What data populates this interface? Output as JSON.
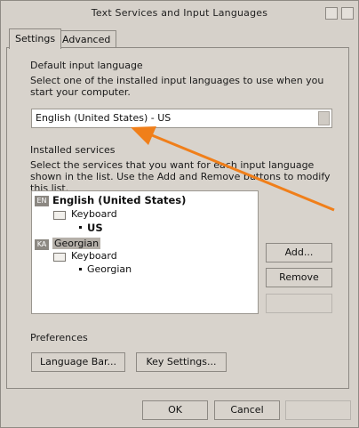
{
  "window": {
    "title": "Text Services and Input Languages"
  },
  "tabs": [
    {
      "label": "Settings",
      "active": true
    },
    {
      "label": "Advanced",
      "active": false
    }
  ],
  "default_input": {
    "label": "Default input language",
    "description": "Select one of the installed input languages to use when you start your computer.",
    "selected": "English (United States) - US"
  },
  "installed": {
    "label": "Installed services",
    "description": "Select the services that you want for each input language shown in the list. Use the Add and Remove buttons to modify this list.",
    "languages": [
      {
        "code": "EN",
        "name": "English (United States)",
        "device": "Keyboard",
        "layout": "US"
      },
      {
        "code": "KA",
        "name": "Georgian",
        "device": "Keyboard",
        "layout": "Georgian"
      }
    ]
  },
  "side_buttons": {
    "add": "Add...",
    "remove": "Remove",
    "properties": ""
  },
  "preferences": {
    "label": "Preferences",
    "language_bar": "Language Bar...",
    "key_settings": "Key Settings..."
  },
  "footer": {
    "ok": "OK",
    "cancel": "Cancel",
    "apply": ""
  },
  "colors": {
    "window_bg": "#d6d1ca",
    "annotation_arrow": "#f07f1a",
    "selection_bg": "#b5b0a9"
  }
}
